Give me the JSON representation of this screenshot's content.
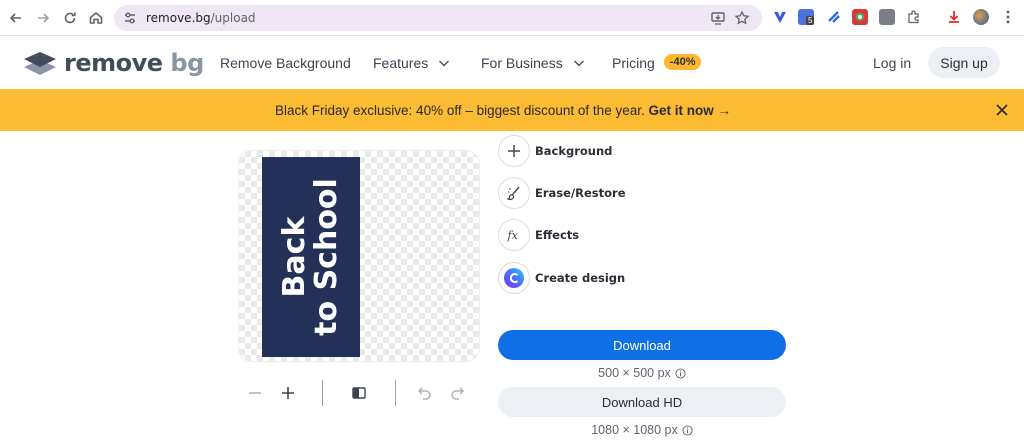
{
  "browser": {
    "url_host": "remove.bg",
    "url_path": "/upload",
    "extension_badge": "5"
  },
  "header": {
    "logo_word_dark": "remove",
    "logo_word_light": "bg",
    "menu": [
      {
        "label": "Remove Background"
      },
      {
        "label": "Features"
      },
      {
        "label": "For Business"
      },
      {
        "label": "Pricing",
        "badge": "-40%"
      }
    ],
    "login_label": "Log in",
    "signup_label": "Sign up"
  },
  "promo": {
    "text": "Black Friday exclusive: 40% off – biggest discount of the year.",
    "cta": "Get it now →"
  },
  "preview": {
    "poster_line1": "Back",
    "poster_line2": "to School"
  },
  "edit_tools": [
    {
      "label": "Background",
      "icon": "plus-icon"
    },
    {
      "label": "Erase/Restore",
      "icon": "brush-icon"
    },
    {
      "label": "Effects",
      "icon": "fx-icon"
    },
    {
      "label": "Create design",
      "icon": "canva-icon"
    }
  ],
  "download": {
    "label": "Download",
    "resolution": "500 × 500 px",
    "hd_label": "Download HD",
    "hd_resolution": "1080 × 1080 px"
  },
  "colors": {
    "primary_blue": "#0f70e6",
    "promo_yellow": "#fbbb32",
    "badge_orange": "#ffb72e",
    "poster_navy": "#233057"
  }
}
